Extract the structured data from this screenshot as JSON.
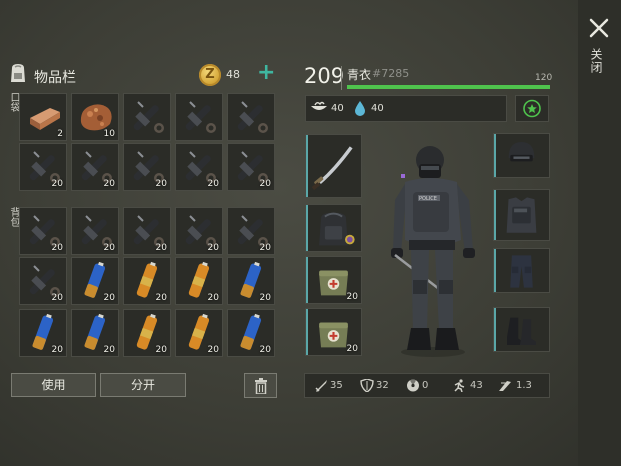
{
  "window": {
    "close_label": "关闭"
  },
  "inventory": {
    "title": "物品栏",
    "coin_symbol": "Z",
    "coins": "48",
    "pocket_label": "口袋",
    "bag_label": "背包",
    "pocket_slots": [
      {
        "item": "copper-ingot",
        "qty": "2"
      },
      {
        "item": "ore-chunk",
        "qty": "10"
      },
      {
        "item": "rifle-scope",
        "qty": ""
      },
      {
        "item": "rifle-scope",
        "qty": ""
      },
      {
        "item": "rifle-scope",
        "qty": ""
      },
      {
        "item": "rifle-scope",
        "qty": "20"
      },
      {
        "item": "rifle-scope",
        "qty": "20"
      },
      {
        "item": "rifle-scope",
        "qty": "20"
      },
      {
        "item": "rifle-scope",
        "qty": "20"
      },
      {
        "item": "rifle-scope",
        "qty": "20"
      }
    ],
    "bag_slots": [
      {
        "item": "rifle-scope",
        "qty": "20"
      },
      {
        "item": "rifle-scope",
        "qty": "20"
      },
      {
        "item": "rifle-scope",
        "qty": "20"
      },
      {
        "item": "rifle-scope",
        "qty": "20"
      },
      {
        "item": "rifle-scope",
        "qty": "20"
      },
      {
        "item": "rifle-scope",
        "qty": "20"
      },
      {
        "item": "blue-battery",
        "qty": "20"
      },
      {
        "item": "orange-battery",
        "qty": "20"
      },
      {
        "item": "orange-battery",
        "qty": "20"
      },
      {
        "item": "blue-battery",
        "qty": "20"
      },
      {
        "item": "blue-battery",
        "qty": "20"
      },
      {
        "item": "blue-battery",
        "qty": "20"
      },
      {
        "item": "orange-battery",
        "qty": "20"
      },
      {
        "item": "orange-battery",
        "qty": "20"
      },
      {
        "item": "blue-battery",
        "qty": "20"
      }
    ],
    "use_label": "使用",
    "split_label": "分开"
  },
  "character": {
    "level": "209",
    "name": "青衣",
    "id": "#7285",
    "xp_max": "120",
    "xp_fraction": 1.0,
    "food": "40",
    "water": "40",
    "left_slots": [
      {
        "item": "katana",
        "qty": ""
      },
      {
        "item": "backpack",
        "qty": ""
      },
      {
        "item": "medkit-bag",
        "qty": "20"
      },
      {
        "item": "medkit-bag",
        "qty": "20"
      }
    ],
    "right_slots": [
      {
        "item": "helmet",
        "qty": ""
      },
      {
        "item": "body-armor",
        "qty": ""
      },
      {
        "item": "tactical-pants",
        "qty": ""
      },
      {
        "item": "combat-boots",
        "qty": ""
      }
    ],
    "stats": {
      "attack": "35",
      "defense": "32",
      "radiation": "0",
      "speed": "43",
      "stealth": "1.3"
    }
  },
  "colors": {
    "accent": "#3fb6a0",
    "xp": "#4fc34d",
    "coin": "#d7a93b"
  }
}
